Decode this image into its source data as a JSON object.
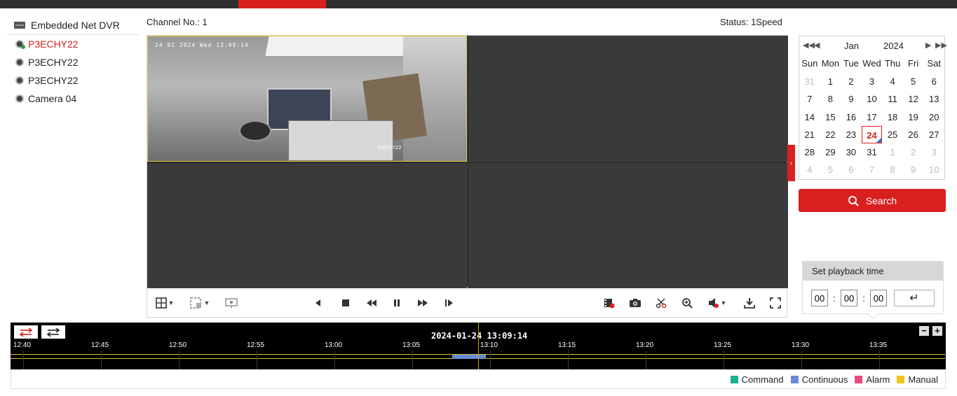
{
  "device_tree": {
    "root_label": "Embedded Net DVR",
    "cameras": [
      {
        "label": "P3ECHY22",
        "selected": true
      },
      {
        "label": "P3ECHY22",
        "selected": false
      },
      {
        "label": "P3ECHY22",
        "selected": false
      },
      {
        "label": "Camera 04",
        "selected": false
      }
    ]
  },
  "header": {
    "channel": "Channel No.: 1",
    "status": "Status: 1Speed"
  },
  "video": {
    "osd_time": "24 01 2024 Wed 13:09:14",
    "osd_cam": "P3ECHY22"
  },
  "calendar": {
    "month": "Jan",
    "year": "2024",
    "dow": [
      "Sun",
      "Mon",
      "Tue",
      "Wed",
      "Thu",
      "Fri",
      "Sat"
    ],
    "days": [
      {
        "d": "31",
        "other": true
      },
      {
        "d": "1"
      },
      {
        "d": "2"
      },
      {
        "d": "3"
      },
      {
        "d": "4"
      },
      {
        "d": "5"
      },
      {
        "d": "6"
      },
      {
        "d": "7"
      },
      {
        "d": "8"
      },
      {
        "d": "9"
      },
      {
        "d": "10"
      },
      {
        "d": "11"
      },
      {
        "d": "12"
      },
      {
        "d": "13"
      },
      {
        "d": "14"
      },
      {
        "d": "15"
      },
      {
        "d": "16"
      },
      {
        "d": "17"
      },
      {
        "d": "18"
      },
      {
        "d": "19"
      },
      {
        "d": "20"
      },
      {
        "d": "21"
      },
      {
        "d": "22"
      },
      {
        "d": "23"
      },
      {
        "d": "24",
        "today": true
      },
      {
        "d": "25"
      },
      {
        "d": "26"
      },
      {
        "d": "27"
      },
      {
        "d": "28"
      },
      {
        "d": "29"
      },
      {
        "d": "30"
      },
      {
        "d": "31"
      },
      {
        "d": "1",
        "other": true
      },
      {
        "d": "2",
        "other": true
      },
      {
        "d": "3",
        "other": true
      },
      {
        "d": "4",
        "other": true
      },
      {
        "d": "5",
        "other": true
      },
      {
        "d": "6",
        "other": true
      },
      {
        "d": "7",
        "other": true
      },
      {
        "d": "8",
        "other": true
      },
      {
        "d": "9",
        "other": true
      },
      {
        "d": "10",
        "other": true
      }
    ]
  },
  "search": {
    "label": "Search"
  },
  "playback_time": {
    "title": "Set playback time",
    "hh": "00",
    "mm": "00",
    "ss": "00"
  },
  "timeline": {
    "current": "2024-01-24 13:09:14",
    "ticks": [
      "12:40",
      "12:45",
      "12:50",
      "12:55",
      "13:00",
      "13:05",
      "13:10",
      "13:15",
      "13:20",
      "13:25",
      "13:30",
      "13:35"
    ]
  },
  "legend": [
    {
      "label": "Command",
      "color": "#19b394"
    },
    {
      "label": "Continuous",
      "color": "#6b8bd6"
    },
    {
      "label": "Alarm",
      "color": "#e84c7d"
    },
    {
      "label": "Manual",
      "color": "#f2c318"
    }
  ],
  "colors": {
    "accent": "#d9201f",
    "recording": "#6b8bd6"
  }
}
